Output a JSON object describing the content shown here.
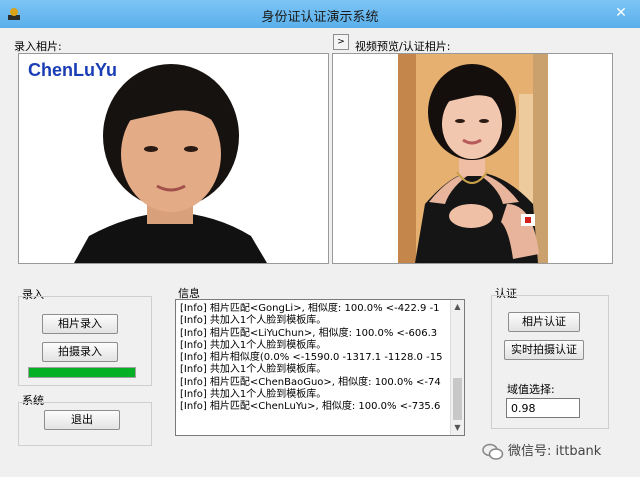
{
  "window": {
    "title": "身份证认证演示系统",
    "close_glyph": "✕",
    "title_color": "#5ab0ec"
  },
  "left_panel": {
    "label": "录入相片:",
    "watermark_name": "ChenLuYu"
  },
  "right_panel": {
    "toggle_glyph": ">",
    "label": "视频预览/认证相片:"
  },
  "enroll": {
    "group_label": "录入",
    "photo_button": "相片录入",
    "capture_button": "拍摄录入",
    "progress": 1.0
  },
  "system": {
    "group_label": "系统",
    "exit_button": "退出"
  },
  "info": {
    "group_label": "信息",
    "lines": [
      "[Info] 相片匹配<GongLi>, 相似度: 100.0% <-422.9 -1",
      "[Info] 共加入1个人脸到模板库。",
      "[Info] 相片匹配<LiYuChun>, 相似度: 100.0% <-606.3",
      "[Info] 共加入1个人脸到模板库。",
      "[Info] 相片相似度(0.0% <-1590.0 -1317.1 -1128.0 -15",
      "[Info] 共加入1个人脸到模板库。",
      "[Info] 相片匹配<ChenBaoGuo>, 相似度: 100.0% <-74",
      "[Info] 共加入1个人脸到模板库。",
      "[Info] 相片匹配<ChenLuYu>, 相似度: 100.0% <-735.6"
    ]
  },
  "auth": {
    "group_label": "认证",
    "photo_button": "相片认证",
    "realtime_button": "实时拍摄认证",
    "threshold_label": "域值选择:",
    "threshold_value": "0.98"
  },
  "footer": {
    "wechat_text": "微信号: ittbank"
  },
  "colors": {
    "progress": "#06b025",
    "watermark_text": "#1a3db5"
  }
}
